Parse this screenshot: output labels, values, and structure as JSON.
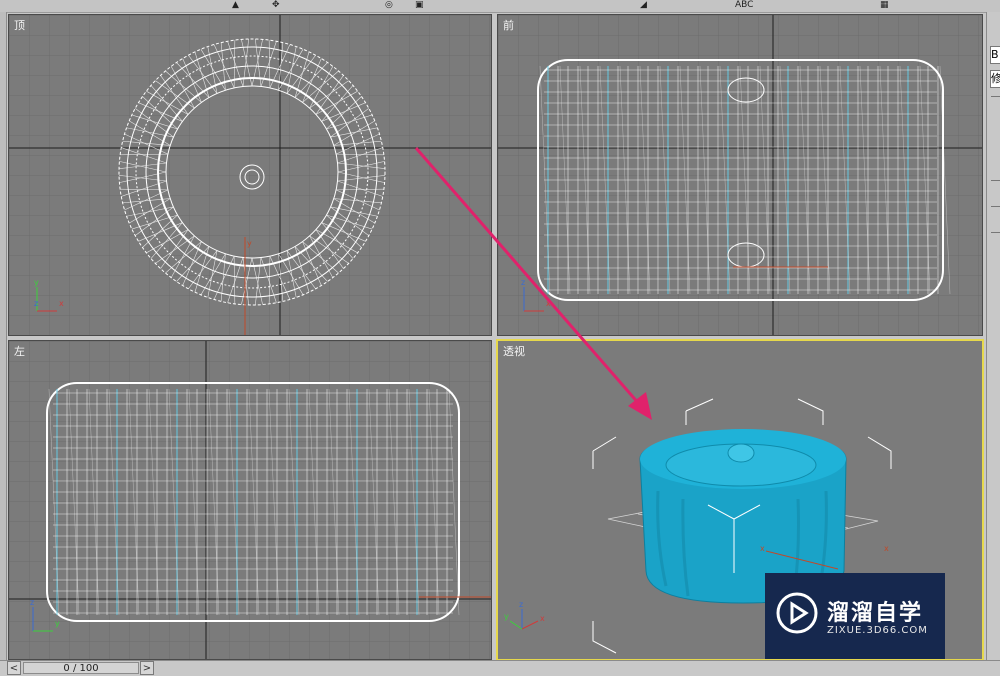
{
  "toolbar": {
    "text_label": "ABC"
  },
  "viewports": {
    "top": {
      "label": "顶"
    },
    "front": {
      "label": "前"
    },
    "left": {
      "label": "左"
    },
    "perspective": {
      "label": "透视"
    }
  },
  "right_panel": {
    "field1": "B",
    "field2": "修"
  },
  "timeline": {
    "frame": "0 / 100",
    "prev_icon": "<",
    "next_icon": ">"
  },
  "watermark": {
    "title": "溜溜自学",
    "url": "ZIXUE.3D66.COM"
  },
  "colors": {
    "viewport_bg": "#7b7b7b",
    "wireframe": "#ffffff",
    "wire_accent": "#66c8e0",
    "object": "#1aa3c8",
    "active_border": "#e6d84c",
    "arrow": "#e0226b",
    "watermark_bg": "#16284e"
  }
}
